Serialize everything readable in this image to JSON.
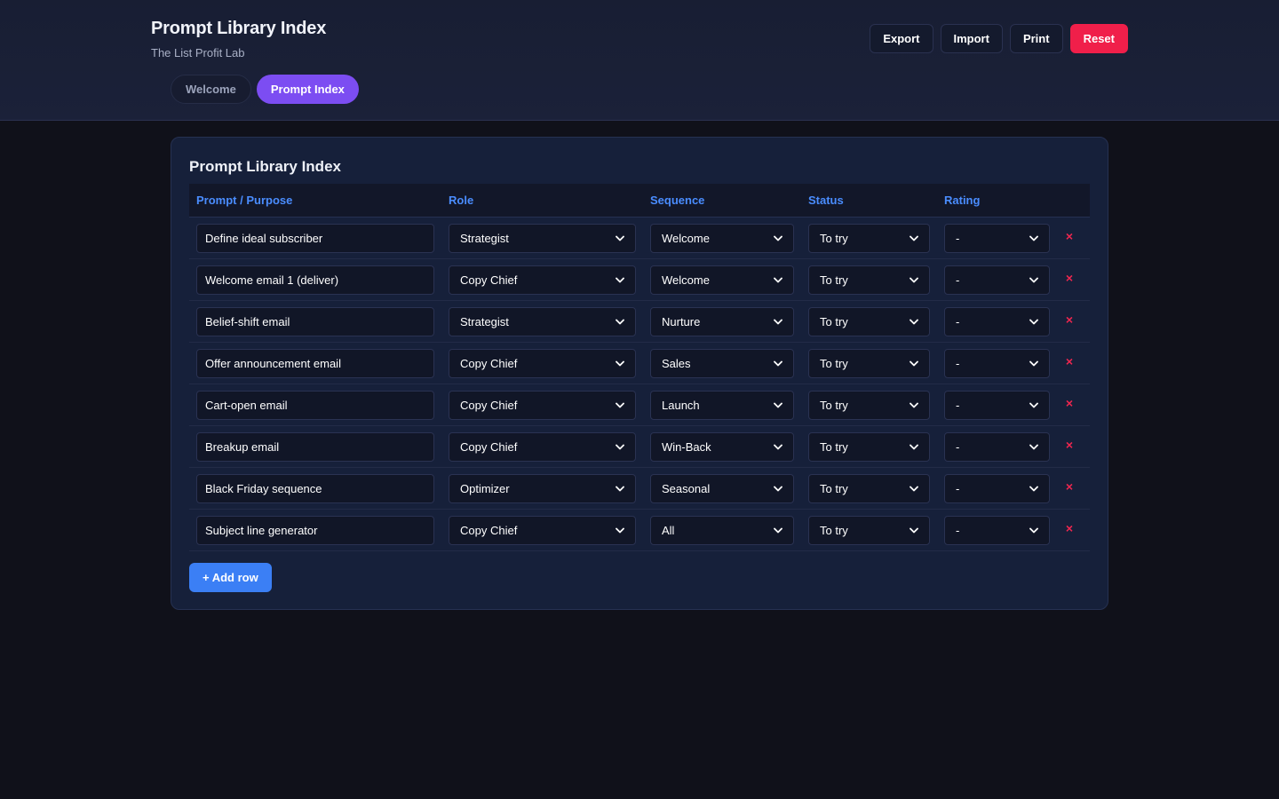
{
  "header": {
    "title": "Prompt Library Index",
    "subtitle": "The List Profit Lab",
    "tabs": [
      {
        "label": "Welcome",
        "active": false
      },
      {
        "label": "Prompt Index",
        "active": true
      }
    ],
    "actions": {
      "export": "Export",
      "import": "Import",
      "print": "Print",
      "reset": "Reset"
    }
  },
  "colors": {
    "accent": "#7c4df2",
    "header_text": "#4a8dff",
    "danger": "#f01f4a",
    "primary_button": "#3b7ff5"
  },
  "icons": {
    "select": "chevron-down-icon",
    "delete": "close-icon"
  },
  "card": {
    "title": "Prompt Library Index",
    "columns": [
      "Prompt / Purpose",
      "Role",
      "Sequence",
      "Status",
      "Rating"
    ],
    "rows": [
      {
        "prompt": "Define ideal subscriber",
        "role": "Strategist",
        "sequence": "Welcome",
        "status": "To try",
        "rating": "-",
        "delete": "×"
      },
      {
        "prompt": "Welcome email 1 (deliver)",
        "role": "Copy Chief",
        "sequence": "Welcome",
        "status": "To try",
        "rating": "-",
        "delete": "×"
      },
      {
        "prompt": "Belief-shift email",
        "role": "Strategist",
        "sequence": "Nurture",
        "status": "To try",
        "rating": "-",
        "delete": "×"
      },
      {
        "prompt": "Offer announcement email",
        "role": "Copy Chief",
        "sequence": "Sales",
        "status": "To try",
        "rating": "-",
        "delete": "×"
      },
      {
        "prompt": "Cart-open email",
        "role": "Copy Chief",
        "sequence": "Launch",
        "status": "To try",
        "rating": "-",
        "delete": "×"
      },
      {
        "prompt": "Breakup email",
        "role": "Copy Chief",
        "sequence": "Win-Back",
        "status": "To try",
        "rating": "-",
        "delete": "×"
      },
      {
        "prompt": "Black Friday sequence",
        "role": "Optimizer",
        "sequence": "Seasonal",
        "status": "To try",
        "rating": "-",
        "delete": "×"
      },
      {
        "prompt": "Subject line generator",
        "role": "Copy Chief",
        "sequence": "All",
        "status": "To try",
        "rating": "-",
        "delete": "×"
      }
    ],
    "add_row_label": "+ Add row"
  }
}
